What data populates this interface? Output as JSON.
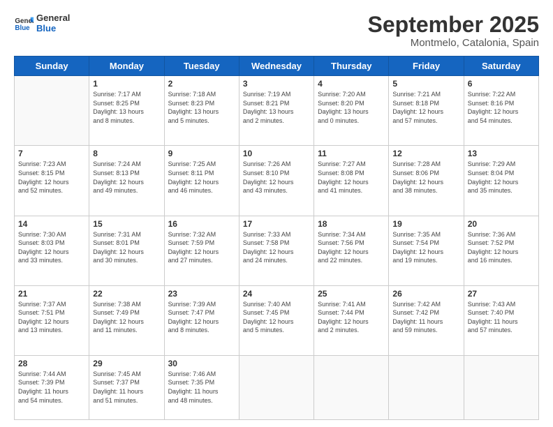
{
  "logo": {
    "text_general": "General",
    "text_blue": "Blue"
  },
  "header": {
    "month": "September 2025",
    "location": "Montmelo, Catalonia, Spain"
  },
  "days": [
    "Sunday",
    "Monday",
    "Tuesday",
    "Wednesday",
    "Thursday",
    "Friday",
    "Saturday"
  ],
  "weeks": [
    [
      {
        "day": "",
        "info": ""
      },
      {
        "day": "1",
        "info": "Sunrise: 7:17 AM\nSunset: 8:25 PM\nDaylight: 13 hours\nand 8 minutes."
      },
      {
        "day": "2",
        "info": "Sunrise: 7:18 AM\nSunset: 8:23 PM\nDaylight: 13 hours\nand 5 minutes."
      },
      {
        "day": "3",
        "info": "Sunrise: 7:19 AM\nSunset: 8:21 PM\nDaylight: 13 hours\nand 2 minutes."
      },
      {
        "day": "4",
        "info": "Sunrise: 7:20 AM\nSunset: 8:20 PM\nDaylight: 13 hours\nand 0 minutes."
      },
      {
        "day": "5",
        "info": "Sunrise: 7:21 AM\nSunset: 8:18 PM\nDaylight: 12 hours\nand 57 minutes."
      },
      {
        "day": "6",
        "info": "Sunrise: 7:22 AM\nSunset: 8:16 PM\nDaylight: 12 hours\nand 54 minutes."
      }
    ],
    [
      {
        "day": "7",
        "info": "Sunrise: 7:23 AM\nSunset: 8:15 PM\nDaylight: 12 hours\nand 52 minutes."
      },
      {
        "day": "8",
        "info": "Sunrise: 7:24 AM\nSunset: 8:13 PM\nDaylight: 12 hours\nand 49 minutes."
      },
      {
        "day": "9",
        "info": "Sunrise: 7:25 AM\nSunset: 8:11 PM\nDaylight: 12 hours\nand 46 minutes."
      },
      {
        "day": "10",
        "info": "Sunrise: 7:26 AM\nSunset: 8:10 PM\nDaylight: 12 hours\nand 43 minutes."
      },
      {
        "day": "11",
        "info": "Sunrise: 7:27 AM\nSunset: 8:08 PM\nDaylight: 12 hours\nand 41 minutes."
      },
      {
        "day": "12",
        "info": "Sunrise: 7:28 AM\nSunset: 8:06 PM\nDaylight: 12 hours\nand 38 minutes."
      },
      {
        "day": "13",
        "info": "Sunrise: 7:29 AM\nSunset: 8:04 PM\nDaylight: 12 hours\nand 35 minutes."
      }
    ],
    [
      {
        "day": "14",
        "info": "Sunrise: 7:30 AM\nSunset: 8:03 PM\nDaylight: 12 hours\nand 33 minutes."
      },
      {
        "day": "15",
        "info": "Sunrise: 7:31 AM\nSunset: 8:01 PM\nDaylight: 12 hours\nand 30 minutes."
      },
      {
        "day": "16",
        "info": "Sunrise: 7:32 AM\nSunset: 7:59 PM\nDaylight: 12 hours\nand 27 minutes."
      },
      {
        "day": "17",
        "info": "Sunrise: 7:33 AM\nSunset: 7:58 PM\nDaylight: 12 hours\nand 24 minutes."
      },
      {
        "day": "18",
        "info": "Sunrise: 7:34 AM\nSunset: 7:56 PM\nDaylight: 12 hours\nand 22 minutes."
      },
      {
        "day": "19",
        "info": "Sunrise: 7:35 AM\nSunset: 7:54 PM\nDaylight: 12 hours\nand 19 minutes."
      },
      {
        "day": "20",
        "info": "Sunrise: 7:36 AM\nSunset: 7:52 PM\nDaylight: 12 hours\nand 16 minutes."
      }
    ],
    [
      {
        "day": "21",
        "info": "Sunrise: 7:37 AM\nSunset: 7:51 PM\nDaylight: 12 hours\nand 13 minutes."
      },
      {
        "day": "22",
        "info": "Sunrise: 7:38 AM\nSunset: 7:49 PM\nDaylight: 12 hours\nand 11 minutes."
      },
      {
        "day": "23",
        "info": "Sunrise: 7:39 AM\nSunset: 7:47 PM\nDaylight: 12 hours\nand 8 minutes."
      },
      {
        "day": "24",
        "info": "Sunrise: 7:40 AM\nSunset: 7:45 PM\nDaylight: 12 hours\nand 5 minutes."
      },
      {
        "day": "25",
        "info": "Sunrise: 7:41 AM\nSunset: 7:44 PM\nDaylight: 12 hours\nand 2 minutes."
      },
      {
        "day": "26",
        "info": "Sunrise: 7:42 AM\nSunset: 7:42 PM\nDaylight: 11 hours\nand 59 minutes."
      },
      {
        "day": "27",
        "info": "Sunrise: 7:43 AM\nSunset: 7:40 PM\nDaylight: 11 hours\nand 57 minutes."
      }
    ],
    [
      {
        "day": "28",
        "info": "Sunrise: 7:44 AM\nSunset: 7:39 PM\nDaylight: 11 hours\nand 54 minutes."
      },
      {
        "day": "29",
        "info": "Sunrise: 7:45 AM\nSunset: 7:37 PM\nDaylight: 11 hours\nand 51 minutes."
      },
      {
        "day": "30",
        "info": "Sunrise: 7:46 AM\nSunset: 7:35 PM\nDaylight: 11 hours\nand 48 minutes."
      },
      {
        "day": "",
        "info": ""
      },
      {
        "day": "",
        "info": ""
      },
      {
        "day": "",
        "info": ""
      },
      {
        "day": "",
        "info": ""
      }
    ]
  ]
}
